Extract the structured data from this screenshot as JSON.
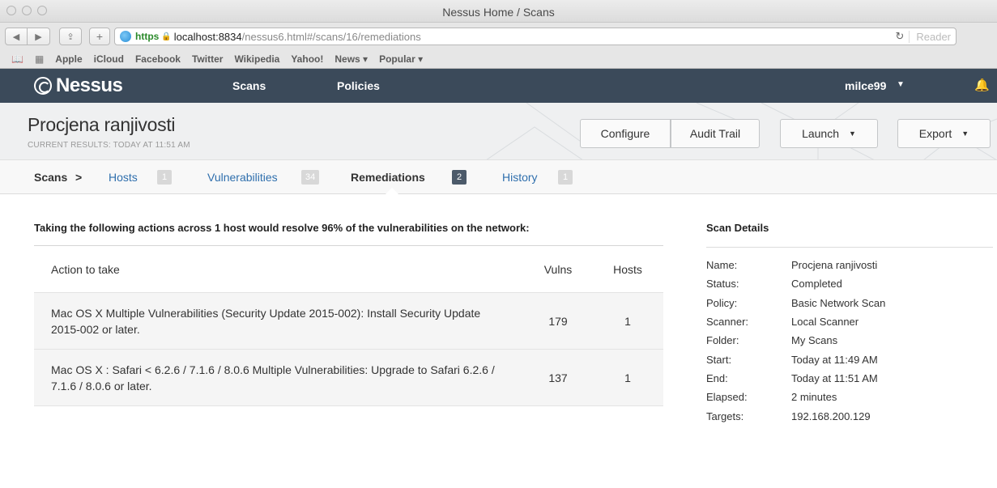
{
  "browser": {
    "window_title": "Nessus Home / Scans",
    "url_scheme": "https",
    "url_host": "localhost:8834",
    "url_path": "/nessus6.html#/scans/16/remediations",
    "reader_label": "Reader",
    "bookmarks": [
      "Apple",
      "iCloud",
      "Facebook",
      "Twitter",
      "Wikipedia",
      "Yahoo!",
      "News ▾",
      "Popular ▾"
    ]
  },
  "nav": {
    "brand": "Nessus",
    "links": {
      "scans": "Scans",
      "policies": "Policies"
    },
    "user": "milce99"
  },
  "header": {
    "title": "Procjena ranjivosti",
    "subtitle": "CURRENT RESULTS: TODAY AT 11:51 AM",
    "buttons": {
      "configure": "Configure",
      "audit_trail": "Audit Trail",
      "launch": "Launch",
      "export": "Export"
    }
  },
  "tabs": {
    "root": "Scans",
    "separator": ">",
    "hosts": {
      "label": "Hosts",
      "count": "1"
    },
    "vulnerabilities": {
      "label": "Vulnerabilities",
      "count": "34"
    },
    "remediations": {
      "label": "Remediations",
      "count": "2"
    },
    "history": {
      "label": "History",
      "count": "1"
    }
  },
  "remediations": {
    "summary": "Taking the following actions across 1 host would resolve 96% of the vulnerabilities on the network:",
    "columns": {
      "action": "Action to take",
      "vulns": "Vulns",
      "hosts": "Hosts"
    },
    "rows": [
      {
        "action": "Mac OS X Multiple Vulnerabilities (Security Update 2015-002): Install Security Update 2015-002 or later.",
        "vulns": "179",
        "hosts": "1"
      },
      {
        "action": "Mac OS X : Safari < 6.2.6 / 7.1.6 / 8.0.6 Multiple Vulnerabilities: Upgrade to Safari 6.2.6 / 7.1.6 / 8.0.6 or later.",
        "vulns": "137",
        "hosts": "1"
      }
    ]
  },
  "scan_details": {
    "title": "Scan Details",
    "rows": [
      {
        "label": "Name:",
        "value": "Procjena ranjivosti"
      },
      {
        "label": "Status:",
        "value": "Completed"
      },
      {
        "label": "Policy:",
        "value": "Basic Network Scan"
      },
      {
        "label": "Scanner:",
        "value": "Local Scanner"
      },
      {
        "label": "Folder:",
        "value": "My Scans"
      },
      {
        "label": "Start:",
        "value": "Today at 11:49 AM"
      },
      {
        "label": "End:",
        "value": "Today at 11:51 AM"
      },
      {
        "label": "Elapsed:",
        "value": "2 minutes"
      },
      {
        "label": "Targets:",
        "value": "192.168.200.129"
      }
    ]
  }
}
